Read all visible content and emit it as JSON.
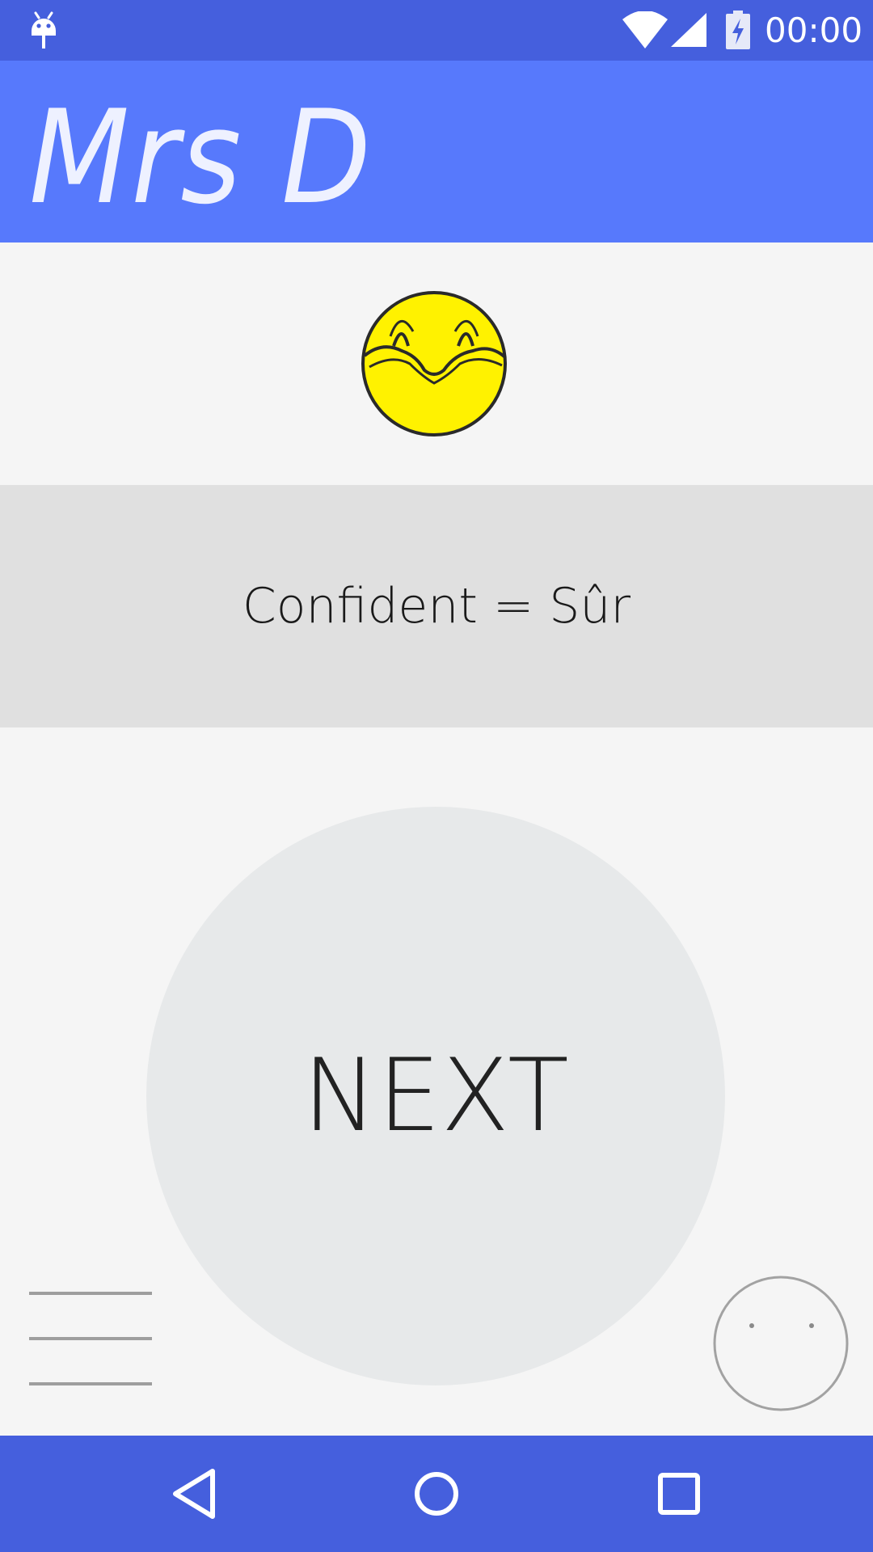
{
  "status_bar": {
    "time": "00:00",
    "icons": [
      "android-icon",
      "wifi-icon",
      "signal-icon",
      "battery-charging-icon"
    ]
  },
  "app_bar": {
    "title": "Mrs D"
  },
  "card": {
    "emoji": "confident-smiley-icon",
    "phrase": "Confident = Sûr"
  },
  "next_button": {
    "label": "NEXT"
  },
  "controls": {
    "menu_icon": "hamburger-menu-icon",
    "face_icon": "face-outline-icon"
  },
  "nav_bar": {
    "icons": [
      "back-icon",
      "home-icon",
      "recents-icon"
    ]
  },
  "colors": {
    "status_bar": "#455fdd",
    "app_bar": "#5779fc",
    "phrase_band": "#e0e0e0",
    "next_circle": "#e7e9ea",
    "emoji_fill": "#fff200"
  }
}
